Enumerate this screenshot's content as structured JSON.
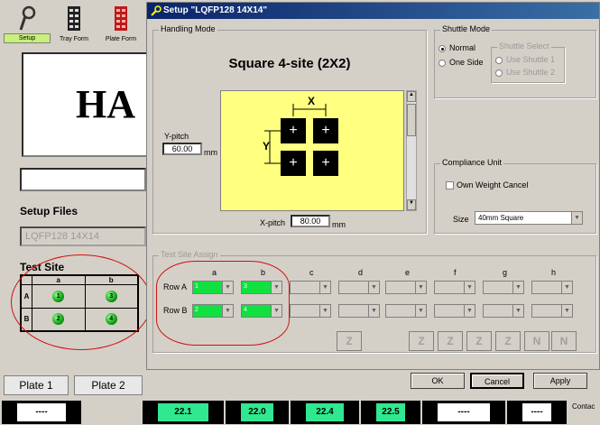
{
  "toolbar": {
    "items": [
      {
        "label": "Setup"
      },
      {
        "label": "Tray Form"
      },
      {
        "label": "Plate Form"
      }
    ]
  },
  "left": {
    "ha_text": "HA",
    "setup_files_label": "Setup Files",
    "setup_file_value": "LQFP128 14X14",
    "test_site_label": "Test Site",
    "grid": {
      "cols": [
        "a",
        "b"
      ],
      "rows": [
        "A",
        "B"
      ],
      "sites": [
        "1",
        "3",
        "2",
        "4"
      ]
    }
  },
  "bottom": {
    "plates": [
      "Plate 1",
      "Plate 2"
    ],
    "cells": [
      "----",
      "22.1",
      "22.0",
      "22.4",
      "22.5",
      "----",
      "----",
      "----"
    ],
    "corner": "Contac"
  },
  "dialog": {
    "title": "Setup \"LQFP128 14X14\"",
    "handling": {
      "title": "Handling Mode",
      "mode": "Square 4-site (2X2)",
      "ypitch_label": "Y-pitch",
      "ypitch": "60.00",
      "xpitch_label": "X-pitch",
      "xpitch": "80.00",
      "unit": "mm",
      "x_mark": "X",
      "y_mark": "Y",
      "plus": "+"
    },
    "shuttle": {
      "title": "Shuttle Mode",
      "normal": "Normal",
      "oneside": "One Side",
      "select_title": "Shuttle Select",
      "s1": "Use Shuttle 1",
      "s2": "Use Shuttle 2"
    },
    "compliance": {
      "title": "Compliance Unit",
      "own_weight": "Own Weight Cancel",
      "size_label": "Size",
      "size_value": "40mm Square"
    },
    "assign": {
      "title": "Test Site Assign",
      "cols": [
        "a",
        "b",
        "c",
        "d",
        "e",
        "f",
        "g",
        "h"
      ],
      "rowA": "Row A",
      "rowB": "Row B",
      "vals": [
        "1",
        "3",
        "2",
        "4"
      ]
    },
    "buttons": {
      "ok": "OK",
      "cancel": "Cancel",
      "apply": "Apply"
    }
  }
}
